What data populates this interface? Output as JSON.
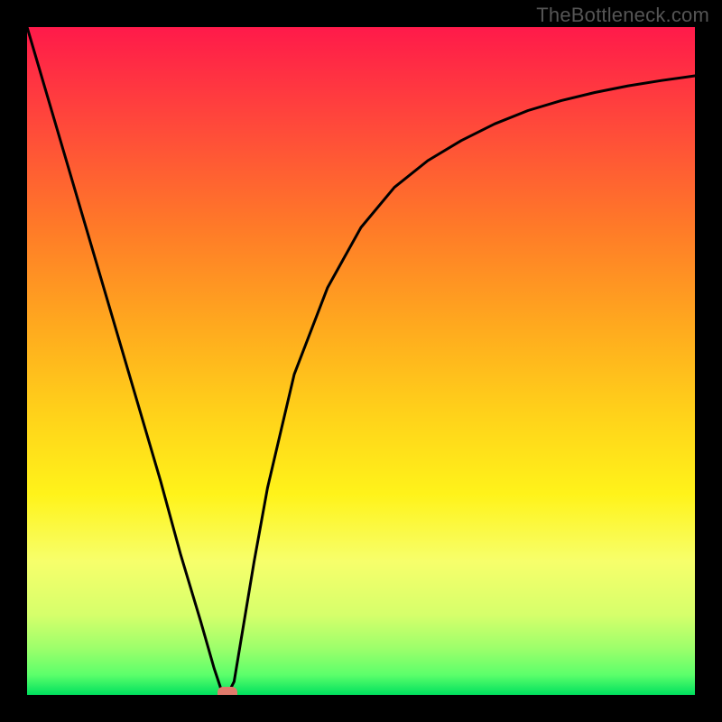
{
  "watermark": "TheBottleneck.com",
  "chart_data": {
    "type": "line",
    "title": "",
    "xlabel": "",
    "ylabel": "",
    "xlim": [
      0,
      100
    ],
    "ylim": [
      0,
      100
    ],
    "grid": false,
    "legend": false,
    "background_gradient_colors_top_to_bottom": [
      "#ff1a4a",
      "#ff5c2f",
      "#ffa51f",
      "#ffd21a",
      "#fff31a",
      "#f7ff6b",
      "#c6ff8c",
      "#5cff6b",
      "#00e05e"
    ],
    "series": [
      {
        "name": "bottleneck-curve",
        "x": [
          0,
          5,
          10,
          15,
          20,
          23,
          26,
          28,
          29,
          30,
          31,
          32,
          34,
          36,
          40,
          45,
          50,
          55,
          60,
          65,
          70,
          75,
          80,
          85,
          90,
          95,
          100
        ],
        "y": [
          100,
          83,
          66,
          49,
          32,
          21,
          11,
          4,
          1,
          0,
          2,
          8,
          20,
          31,
          48,
          61,
          70,
          76,
          80,
          83,
          85.5,
          87.5,
          89,
          90.2,
          91.2,
          92,
          92.7
        ]
      }
    ],
    "markers": [
      {
        "name": "minimum-marker",
        "x": 30,
        "y": 0,
        "color": "#e07a6b",
        "shape": "rounded-rect"
      }
    ]
  }
}
